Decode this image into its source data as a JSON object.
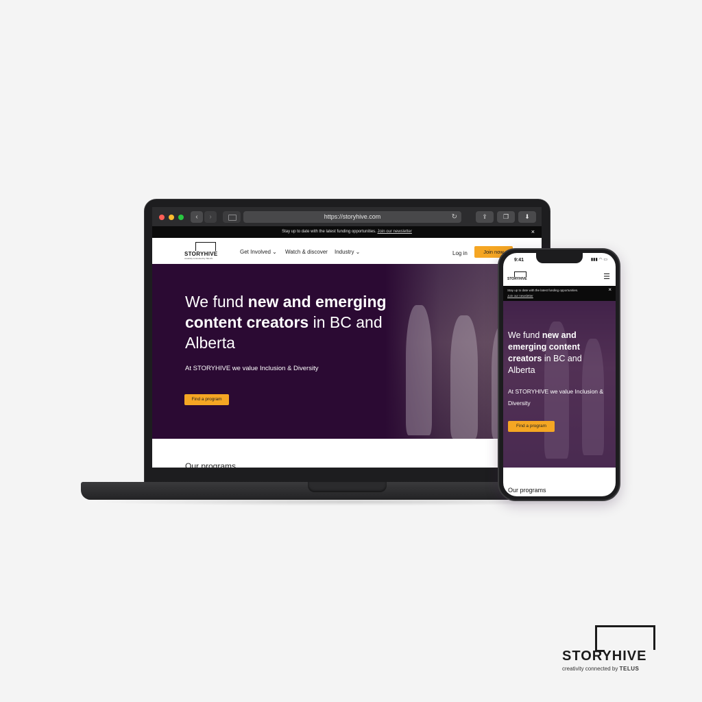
{
  "laptop": {
    "browser": {
      "url": "https://storyhive.com",
      "back_icon": "‹",
      "forward_icon": "›"
    },
    "banner": {
      "text": "Stay up to date with the latest funding opportunities.",
      "link": "Join our newsletter",
      "close": "×"
    },
    "header": {
      "logo": "STORYHIVE",
      "logo_sub": "creativity connected by TELUS",
      "nav": [
        "Get Involved ⌄",
        "Watch & discover",
        "Industry ⌄"
      ],
      "login": "Log in",
      "join": "Join now"
    },
    "hero": {
      "title_1": "We fund ",
      "title_bold": "new and emerging content creators",
      "title_2": " in BC and Alberta",
      "subtitle": "At STORYHIVE we value Inclusion & Diversity",
      "cta": "Find a program"
    },
    "programs_heading": "Our programs"
  },
  "phone": {
    "time": "9:41",
    "status": "▮▮▮ ◠ ▭",
    "logo": "STORYHIVE",
    "menu_icon": "☰",
    "banner": {
      "text": "Stay up to date with the latest funding opportunities.",
      "link": "Join our newsletter",
      "close": "×"
    },
    "hero": {
      "title_1": "We fund ",
      "title_bold": "new and emerging content creators",
      "title_2": " in BC and Alberta",
      "subtitle": "At STORYHIVE we value Inclusion & Diversity",
      "cta": "Find a program"
    },
    "programs_heading": "Our programs"
  },
  "brand": {
    "name": "STORYHIVE",
    "tagline": "creativity connected by",
    "telus": "TELUS"
  },
  "colors": {
    "accent": "#f5a623",
    "hero_bg": "#2b0a33",
    "page_bg": "#f4f4f4"
  }
}
